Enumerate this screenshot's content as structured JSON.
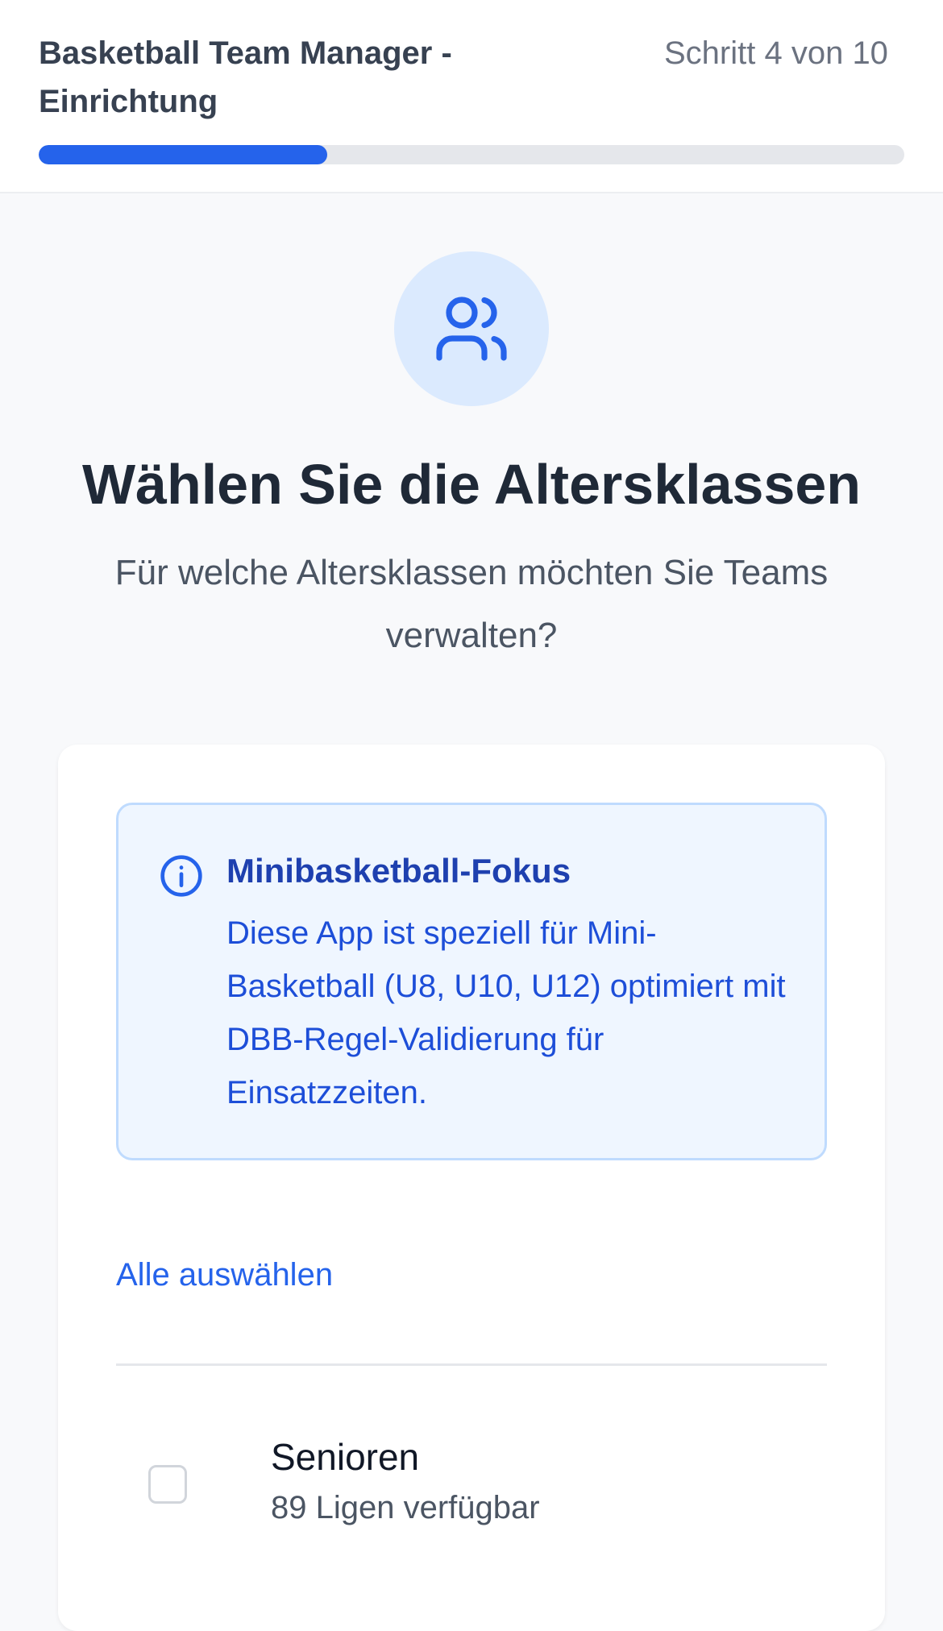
{
  "header": {
    "title": "Basketball Team Manager - Einrichtung",
    "step_label": "Schritt 4 von 10",
    "progress_fraction": 0.4,
    "accent_color": "#2563eb"
  },
  "hero": {
    "icon": "users-icon",
    "title": "Wählen Sie die Altersklassen",
    "subtitle": "Für welche Altersklassen möchten Sie Teams verwalten?"
  },
  "info": {
    "icon": "info-icon",
    "title": "Minibasketball-Fokus",
    "body": "Diese App ist speziell für Mini-Basketball (U8, U10, U12) optimiert mit DBB-Regel-Validierung für Einsatzzeiten."
  },
  "select_all_label": "Alle auswählen",
  "options": [
    {
      "label": "Senioren",
      "sub": "89 Ligen verfügbar",
      "checked": false
    }
  ]
}
